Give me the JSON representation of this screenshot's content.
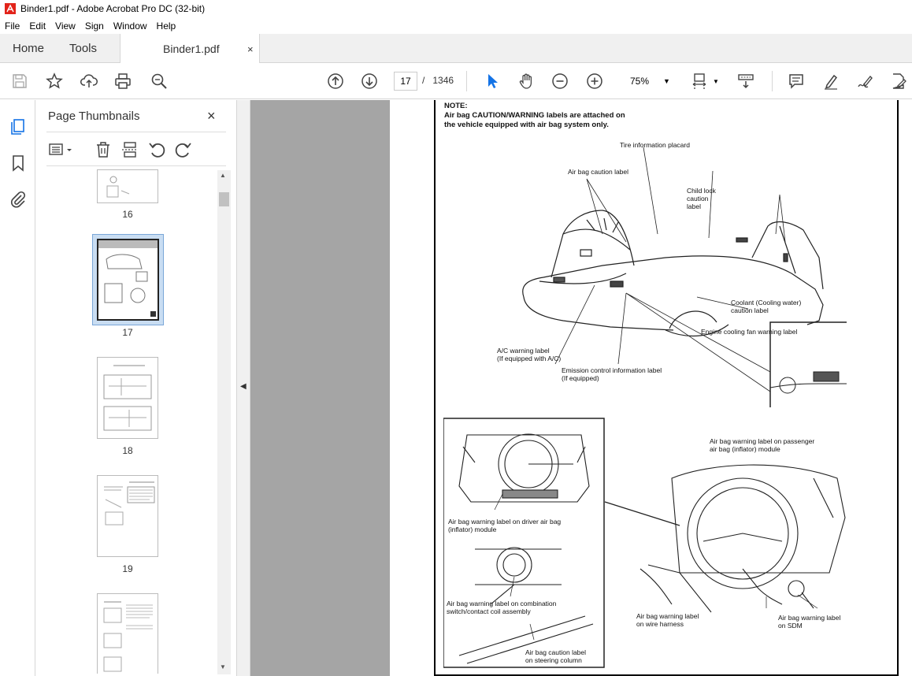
{
  "window": {
    "title": "Binder1.pdf - Adobe Acrobat Pro DC (32-bit)"
  },
  "menu": [
    "File",
    "Edit",
    "View",
    "Sign",
    "Window",
    "Help"
  ],
  "tabs": {
    "home": "Home",
    "tools": "Tools",
    "document": "Binder1.pdf",
    "close": "×"
  },
  "toolbar": {
    "current_page": "17",
    "page_separator": "/",
    "total_pages": "1346",
    "zoom": "75%"
  },
  "panel": {
    "title": "Page Thumbnails",
    "close": "×",
    "thumbnails": [
      {
        "label": "16",
        "selected": false
      },
      {
        "label": "17",
        "selected": true
      },
      {
        "label": "18",
        "selected": false
      },
      {
        "label": "19",
        "selected": false
      },
      {
        "label": "",
        "selected": false
      }
    ]
  },
  "pdf_page": {
    "note_heading": "NOTE:",
    "note_line1": "Air bag CAUTION/WARNING labels are attached on",
    "note_line2": "the vehicle equipped with air bag system only.",
    "labels": {
      "tire_placard": "Tire information placard",
      "airbag_caution": "Air bag caution label",
      "child_lock_1": "Child lock",
      "child_lock_2": "caution",
      "child_lock_3": "label",
      "coolant_1": "Coolant (Cooling water)",
      "coolant_2": "caution label",
      "engine_fan": "Engine cooling fan warning label",
      "ac_1": "A/C warning label",
      "ac_2": "(If equipped with A/C)",
      "emission_1": "Emission control information label",
      "emission_2": "(If equipped)",
      "passenger_1": "Air bag warning label on passenger",
      "passenger_2": "air bag (inflator) module",
      "driver_1": "Air bag warning label on driver air bag",
      "driver_2": "(inflator) module",
      "combo_1": "Air bag warning label on combination",
      "combo_2": "switch/contact coil assembly",
      "harness_1": "Air bag warning label",
      "harness_2": "on wire harness",
      "sdm_1": "Air bag warning label",
      "sdm_2": "on SDM",
      "column_1": "Air bag caution label",
      "column_2": "on steering column"
    }
  },
  "colors": {
    "accent": "#1473e6",
    "chrome": "#f0f0f0",
    "doc_bg": "#a5a5a5",
    "selection": "#c9ddf2"
  },
  "icons": [
    "acrobat-icon",
    "save-icon",
    "bookmark-star-icon",
    "upload-icon",
    "print-icon",
    "zoom-search-icon",
    "page-up-icon",
    "page-down-icon",
    "select-cursor-icon",
    "hand-icon",
    "zoom-out-icon",
    "zoom-in-icon",
    "fit-page-icon",
    "scroll-mode-icon",
    "comment-icon",
    "highlight-icon",
    "sign-icon",
    "edit-pdf-icon"
  ]
}
